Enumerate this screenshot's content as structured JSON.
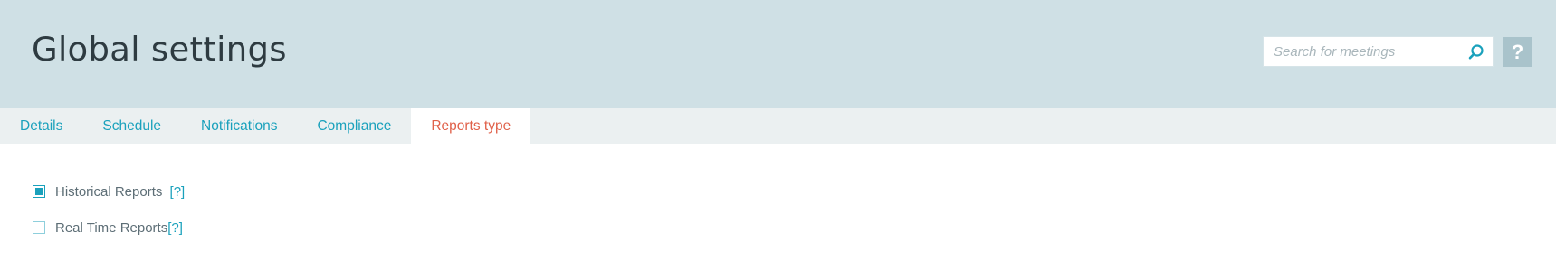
{
  "header": {
    "title": "Global settings",
    "search_placeholder": "Search for meetings",
    "search_value": "",
    "help_label": "?"
  },
  "tabs": [
    {
      "label": "Details",
      "active": false
    },
    {
      "label": "Schedule",
      "active": false
    },
    {
      "label": "Notifications",
      "active": false
    },
    {
      "label": "Compliance",
      "active": false
    },
    {
      "label": "Reports type",
      "active": true
    }
  ],
  "report_options": [
    {
      "label": "Historical Reports",
      "help": "[?]",
      "checked": true
    },
    {
      "label": "Real Time Reports",
      "help": "[?]",
      "checked": false
    }
  ],
  "colors": {
    "accent": "#1aa1bc",
    "active_tab": "#e0614a",
    "header_bg": "#cfe0e5",
    "tabbar_bg": "#ebf0f1"
  },
  "icons": {
    "search": "search-icon",
    "help": "help-icon"
  }
}
